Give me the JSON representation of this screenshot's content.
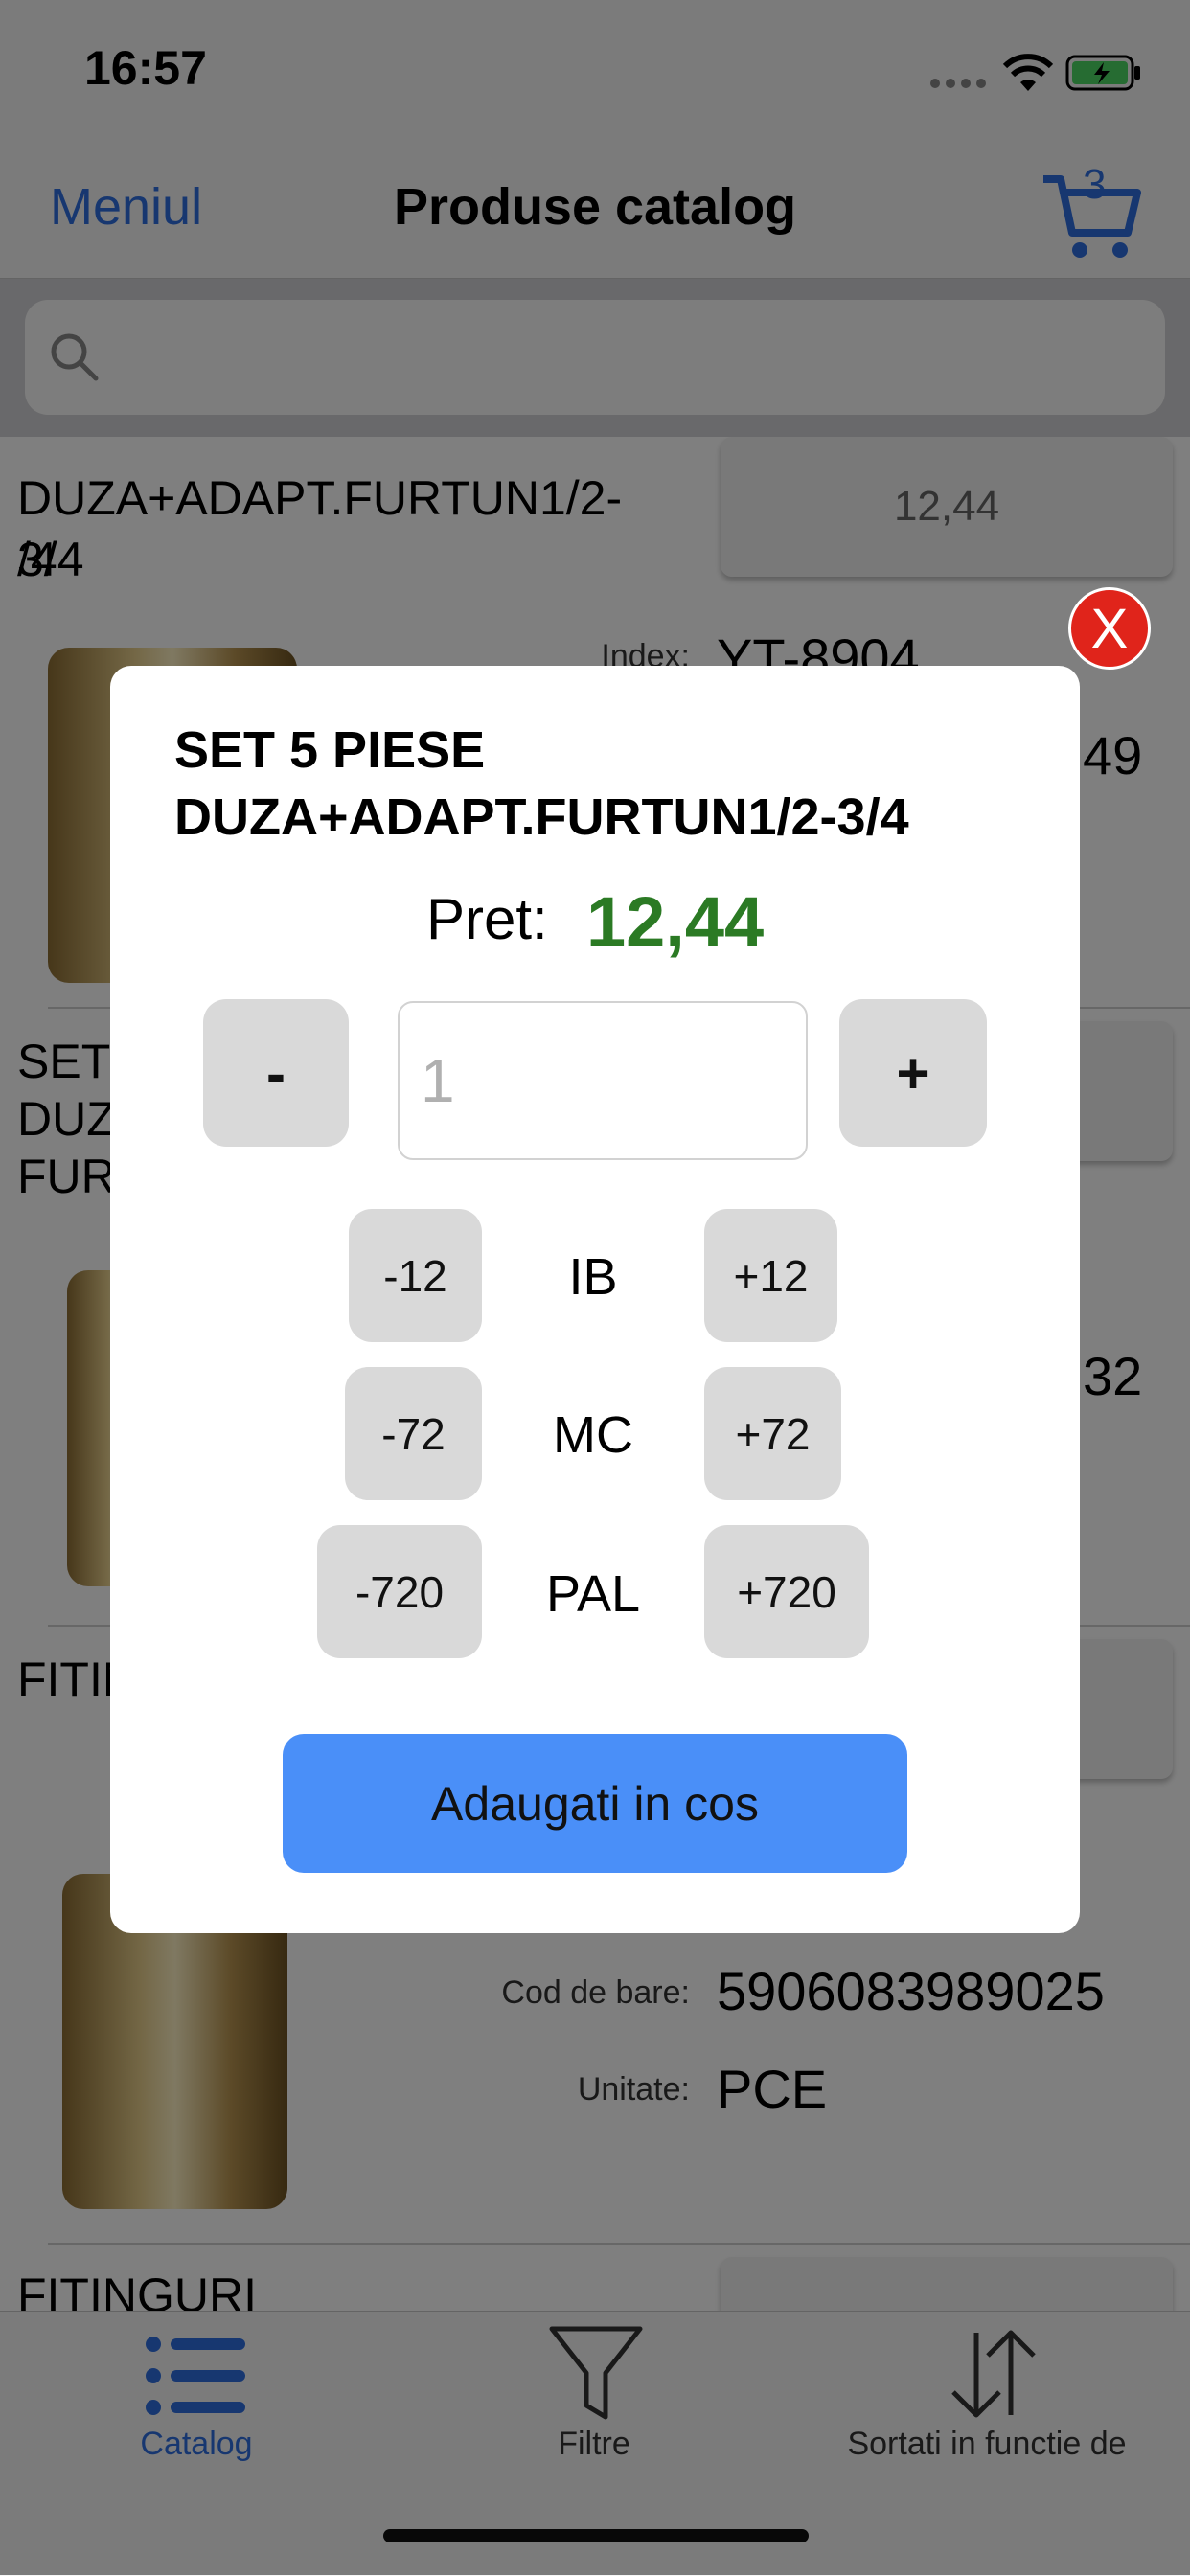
{
  "status_bar": {
    "time": "16:57"
  },
  "nav": {
    "back_label": "Meniul",
    "title": "Produse catalog",
    "cart_count": "3"
  },
  "search": {
    "placeholder": ""
  },
  "list": {
    "item1": {
      "title": "DUZA+ADAPT.FURTUN1/2-3/4",
      "title_line2": "/4",
      "price": "12,44",
      "index_label": "Index:",
      "index_value": "YT-8904",
      "partial_value": "49"
    },
    "item2": {
      "title_lines": [
        "SET",
        "DUZ",
        "FUR"
      ],
      "partial_value": "32"
    },
    "item3": {
      "title": "FITIN",
      "barcode_label": "Cod de bare:",
      "barcode_value": "5906083989025",
      "unit_label": "Unitate:",
      "unit_value": "PCE"
    },
    "item4": {
      "title": "FITINGURI"
    }
  },
  "tabs": [
    {
      "label": "Catalog",
      "icon": "list-icon",
      "active": true
    },
    {
      "label": "Filtre",
      "icon": "filter-icon",
      "active": false
    },
    {
      "label": "Sortati in functie de",
      "icon": "sort-icon",
      "active": false
    }
  ],
  "modal": {
    "close_label": "X",
    "title_line1": "SET 5 PIESE",
    "title_line2": "DUZA+ADAPT.FURTUN1/2-3/4",
    "price_label": "Pret:",
    "price_value": "12,44",
    "minus_label": "-",
    "plus_label": "+",
    "quantity_value": "1",
    "units": [
      {
        "name": "IB",
        "minus": "-12",
        "plus": "+12"
      },
      {
        "name": "MC",
        "minus": "-72",
        "plus": "+72"
      },
      {
        "name": "PAL",
        "minus": "-720",
        "plus": "+720"
      }
    ],
    "add_to_cart_label": "Adaugati in cos"
  },
  "colors": {
    "accent": "#2f6fe0",
    "price_green": "#2b7a24",
    "close_red": "#e0241b",
    "add_button": "#4a8ff8"
  }
}
